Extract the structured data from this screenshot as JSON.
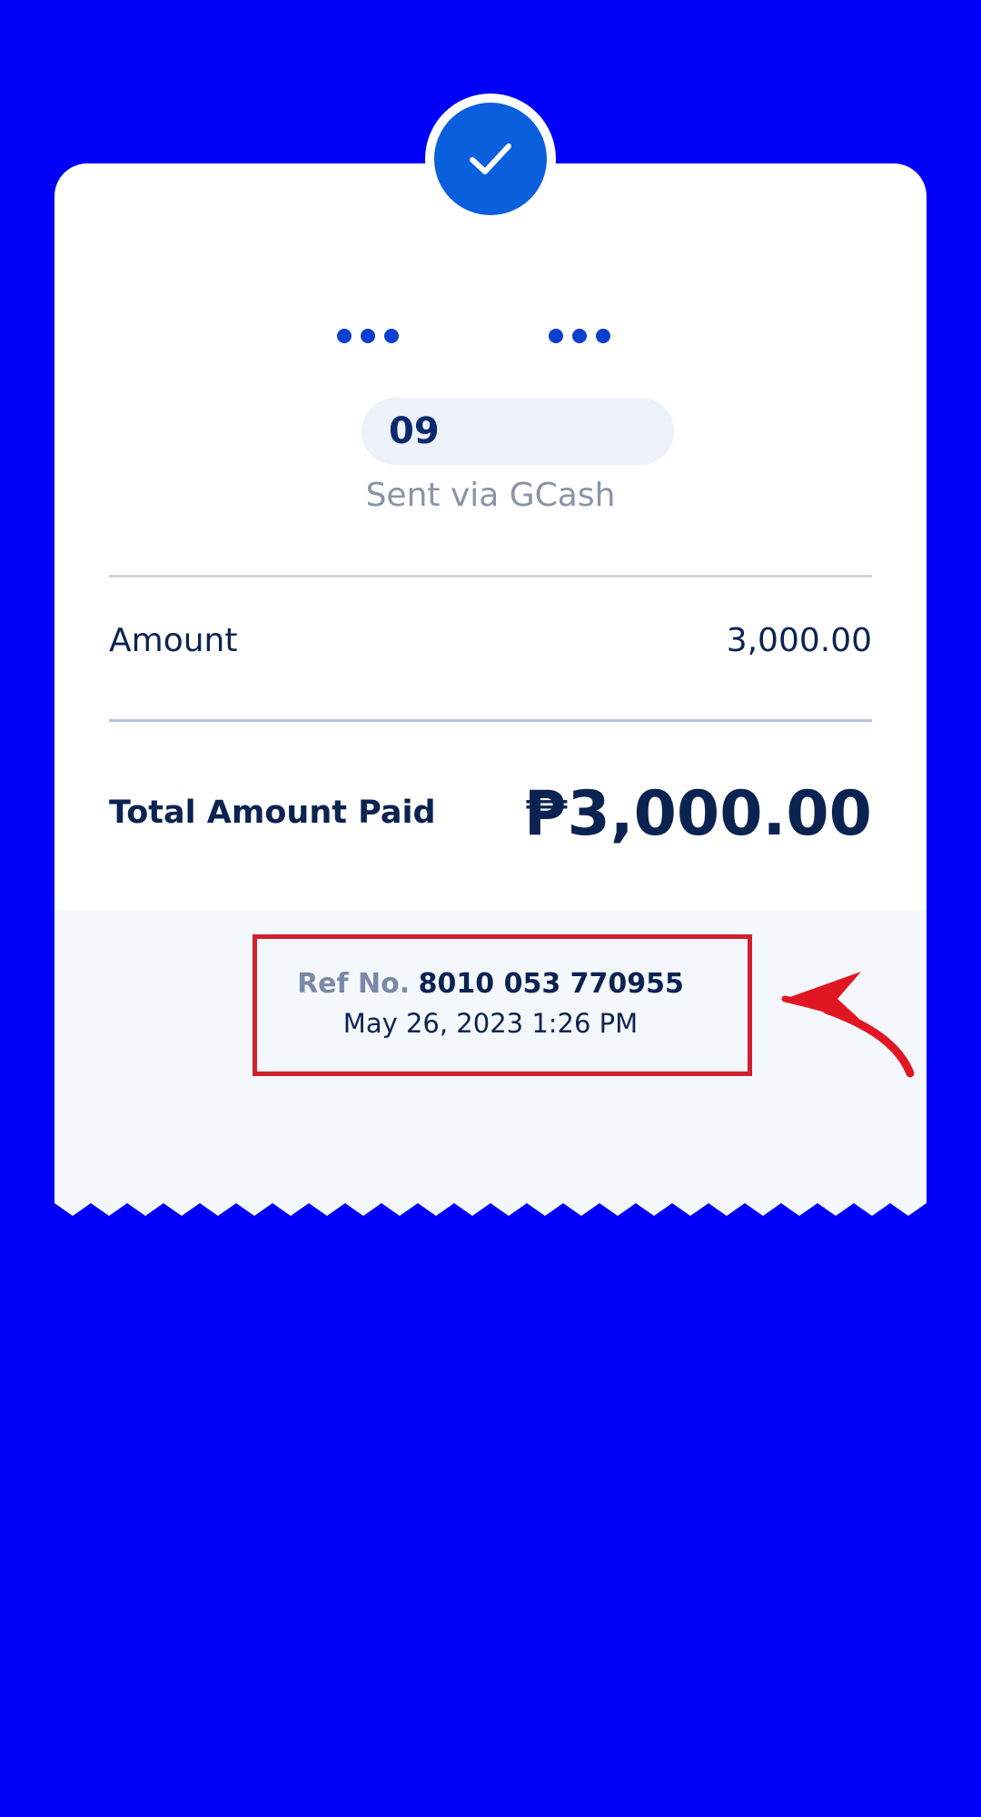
{
  "recipient": {
    "masked_name_left": "•••",
    "masked_name_right": "•••",
    "phone_prefix": "09",
    "sent_via": "Sent via GCash"
  },
  "details": {
    "amount_label": "Amount",
    "amount_value": "3,000.00",
    "total_label": "Total Amount Paid",
    "total_value": "₱3,000.00"
  },
  "reference": {
    "ref_label": "Ref No.",
    "ref_number": "8010 053 770955",
    "datetime": "May 26, 2023 1:26 PM"
  },
  "colors": {
    "background": "#0000fa",
    "accent": "#0a5fdc",
    "highlight_box": "#d0202e"
  },
  "icons": {
    "status": "check-icon",
    "annotation": "arrow-icon"
  }
}
